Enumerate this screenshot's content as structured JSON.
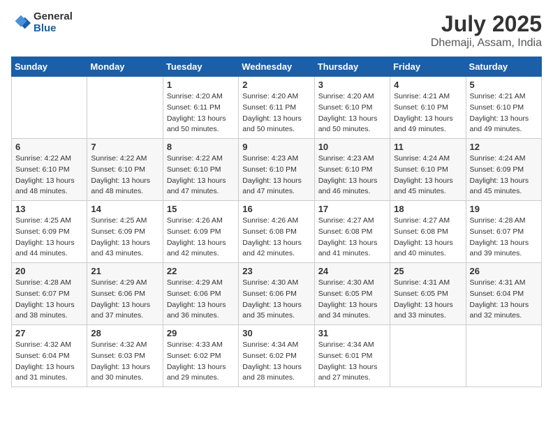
{
  "header": {
    "logo_general": "General",
    "logo_blue": "Blue",
    "month_year": "July 2025",
    "location": "Dhemaji, Assam, India"
  },
  "weekdays": [
    "Sunday",
    "Monday",
    "Tuesday",
    "Wednesday",
    "Thursday",
    "Friday",
    "Saturday"
  ],
  "weeks": [
    [
      {
        "day": "",
        "info": ""
      },
      {
        "day": "",
        "info": ""
      },
      {
        "day": "1",
        "info": "Sunrise: 4:20 AM\nSunset: 6:11 PM\nDaylight: 13 hours\nand 50 minutes."
      },
      {
        "day": "2",
        "info": "Sunrise: 4:20 AM\nSunset: 6:11 PM\nDaylight: 13 hours\nand 50 minutes."
      },
      {
        "day": "3",
        "info": "Sunrise: 4:20 AM\nSunset: 6:10 PM\nDaylight: 13 hours\nand 50 minutes."
      },
      {
        "day": "4",
        "info": "Sunrise: 4:21 AM\nSunset: 6:10 PM\nDaylight: 13 hours\nand 49 minutes."
      },
      {
        "day": "5",
        "info": "Sunrise: 4:21 AM\nSunset: 6:10 PM\nDaylight: 13 hours\nand 49 minutes."
      }
    ],
    [
      {
        "day": "6",
        "info": "Sunrise: 4:22 AM\nSunset: 6:10 PM\nDaylight: 13 hours\nand 48 minutes."
      },
      {
        "day": "7",
        "info": "Sunrise: 4:22 AM\nSunset: 6:10 PM\nDaylight: 13 hours\nand 48 minutes."
      },
      {
        "day": "8",
        "info": "Sunrise: 4:22 AM\nSunset: 6:10 PM\nDaylight: 13 hours\nand 47 minutes."
      },
      {
        "day": "9",
        "info": "Sunrise: 4:23 AM\nSunset: 6:10 PM\nDaylight: 13 hours\nand 47 minutes."
      },
      {
        "day": "10",
        "info": "Sunrise: 4:23 AM\nSunset: 6:10 PM\nDaylight: 13 hours\nand 46 minutes."
      },
      {
        "day": "11",
        "info": "Sunrise: 4:24 AM\nSunset: 6:10 PM\nDaylight: 13 hours\nand 45 minutes."
      },
      {
        "day": "12",
        "info": "Sunrise: 4:24 AM\nSunset: 6:09 PM\nDaylight: 13 hours\nand 45 minutes."
      }
    ],
    [
      {
        "day": "13",
        "info": "Sunrise: 4:25 AM\nSunset: 6:09 PM\nDaylight: 13 hours\nand 44 minutes."
      },
      {
        "day": "14",
        "info": "Sunrise: 4:25 AM\nSunset: 6:09 PM\nDaylight: 13 hours\nand 43 minutes."
      },
      {
        "day": "15",
        "info": "Sunrise: 4:26 AM\nSunset: 6:09 PM\nDaylight: 13 hours\nand 42 minutes."
      },
      {
        "day": "16",
        "info": "Sunrise: 4:26 AM\nSunset: 6:08 PM\nDaylight: 13 hours\nand 42 minutes."
      },
      {
        "day": "17",
        "info": "Sunrise: 4:27 AM\nSunset: 6:08 PM\nDaylight: 13 hours\nand 41 minutes."
      },
      {
        "day": "18",
        "info": "Sunrise: 4:27 AM\nSunset: 6:08 PM\nDaylight: 13 hours\nand 40 minutes."
      },
      {
        "day": "19",
        "info": "Sunrise: 4:28 AM\nSunset: 6:07 PM\nDaylight: 13 hours\nand 39 minutes."
      }
    ],
    [
      {
        "day": "20",
        "info": "Sunrise: 4:28 AM\nSunset: 6:07 PM\nDaylight: 13 hours\nand 38 minutes."
      },
      {
        "day": "21",
        "info": "Sunrise: 4:29 AM\nSunset: 6:06 PM\nDaylight: 13 hours\nand 37 minutes."
      },
      {
        "day": "22",
        "info": "Sunrise: 4:29 AM\nSunset: 6:06 PM\nDaylight: 13 hours\nand 36 minutes."
      },
      {
        "day": "23",
        "info": "Sunrise: 4:30 AM\nSunset: 6:06 PM\nDaylight: 13 hours\nand 35 minutes."
      },
      {
        "day": "24",
        "info": "Sunrise: 4:30 AM\nSunset: 6:05 PM\nDaylight: 13 hours\nand 34 minutes."
      },
      {
        "day": "25",
        "info": "Sunrise: 4:31 AM\nSunset: 6:05 PM\nDaylight: 13 hours\nand 33 minutes."
      },
      {
        "day": "26",
        "info": "Sunrise: 4:31 AM\nSunset: 6:04 PM\nDaylight: 13 hours\nand 32 minutes."
      }
    ],
    [
      {
        "day": "27",
        "info": "Sunrise: 4:32 AM\nSunset: 6:04 PM\nDaylight: 13 hours\nand 31 minutes."
      },
      {
        "day": "28",
        "info": "Sunrise: 4:32 AM\nSunset: 6:03 PM\nDaylight: 13 hours\nand 30 minutes."
      },
      {
        "day": "29",
        "info": "Sunrise: 4:33 AM\nSunset: 6:02 PM\nDaylight: 13 hours\nand 29 minutes."
      },
      {
        "day": "30",
        "info": "Sunrise: 4:34 AM\nSunset: 6:02 PM\nDaylight: 13 hours\nand 28 minutes."
      },
      {
        "day": "31",
        "info": "Sunrise: 4:34 AM\nSunset: 6:01 PM\nDaylight: 13 hours\nand 27 minutes."
      },
      {
        "day": "",
        "info": ""
      },
      {
        "day": "",
        "info": ""
      }
    ]
  ]
}
